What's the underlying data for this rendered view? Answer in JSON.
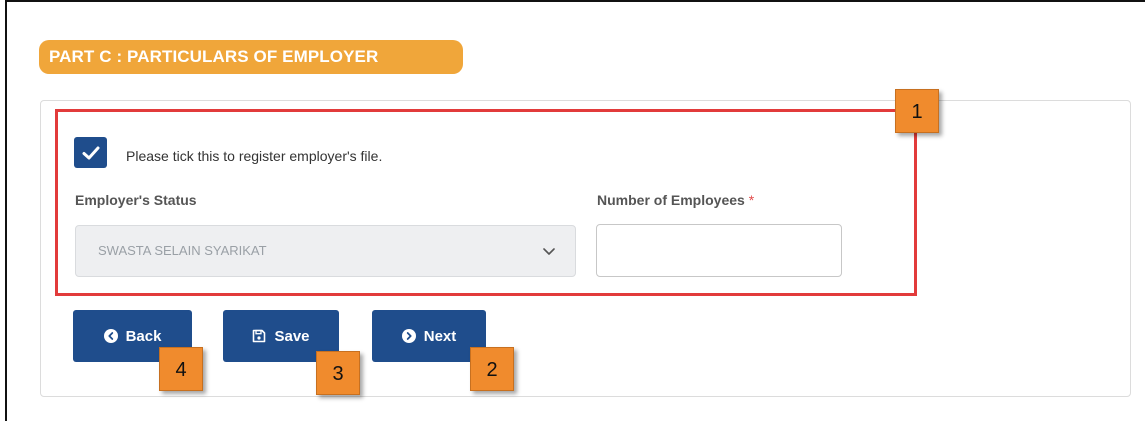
{
  "section": {
    "title": "PART C : PARTICULARS OF EMPLOYER",
    "accent_color": "#f0a63a"
  },
  "form": {
    "checkbox_checked": true,
    "checkbox_label": "Please tick this to register employer's file.",
    "employer_status_label": "Employer's Status",
    "employer_status_value": "SWASTA SELAIN SYARIKAT",
    "employees_label": "Number of Employees",
    "required_mark": "*",
    "employees_value": ""
  },
  "buttons": {
    "back_label": "Back",
    "save_label": "Save",
    "next_label": "Next",
    "color": "#1f4d8c"
  },
  "callouts": {
    "c1": "1",
    "c2": "2",
    "c3": "3",
    "c4": "4"
  },
  "icons": {
    "checkbox": "checkmark-icon",
    "select": "chevron-down-icon",
    "back": "back-circle-icon",
    "save": "floppy-disk-icon",
    "next": "next-circle-icon"
  }
}
